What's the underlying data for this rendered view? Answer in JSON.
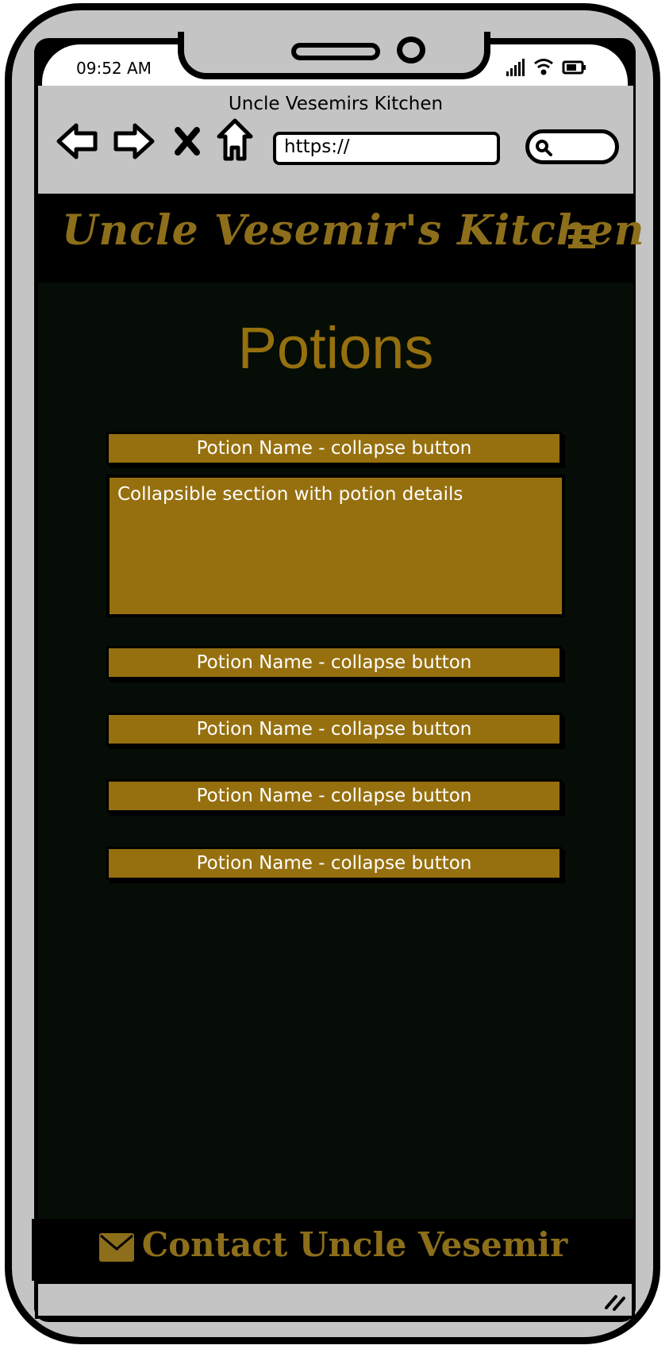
{
  "status_bar": {
    "time": "09:52 AM",
    "signal_icon": "signal-bars-icon",
    "wifi_icon": "wifi-icon",
    "battery_icon": "battery-icon"
  },
  "browser": {
    "title": "Uncle Vesemirs Kitchen",
    "url": "https://",
    "back_icon": "arrow-left-icon",
    "forward_icon": "arrow-right-icon",
    "stop_icon": "close-icon",
    "home_icon": "home-icon",
    "search_icon": "search-icon"
  },
  "header": {
    "brand": "Uncle Vesemir's Kitchen",
    "menu_icon": "hamburger-menu-icon"
  },
  "main": {
    "title": "Potions",
    "potions": [
      {
        "label": "Potion Name - collapse button"
      },
      {
        "label": "Potion Name - collapse button"
      },
      {
        "label": "Potion Name - collapse button"
      },
      {
        "label": "Potion Name - collapse button"
      },
      {
        "label": "Potion Name - collapse button"
      }
    ],
    "expanded_section": "Collapsible section with potion details"
  },
  "footer": {
    "contact": "Contact Uncle Vesemir",
    "mail_icon": "envelope-icon"
  },
  "colors": {
    "accent_gold": "#96700f",
    "brand_gold": "#8d6e1a",
    "content_bg": "#050d06",
    "frame_gray": "#c4c4c4"
  }
}
